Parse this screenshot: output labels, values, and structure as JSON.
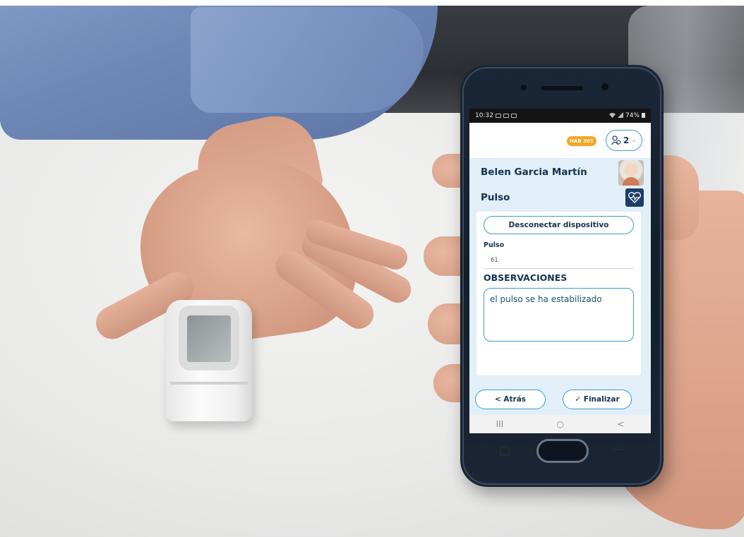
{
  "statusbar": {
    "time": "10:32",
    "notification_icons": [
      "message-icon",
      "mail-icon",
      "image-icon"
    ],
    "battery": "74%",
    "system_icons": [
      "wifi-icon",
      "signal-icon",
      "battery-icon"
    ]
  },
  "header": {
    "room_badge": "HAB 301",
    "users_count": "2",
    "users_icon": "users-icon",
    "chevron_icon": "chevron-down-icon"
  },
  "patient": {
    "name": "Belen Garcia Martín",
    "avatar_icon": "patient-avatar"
  },
  "measurement": {
    "name": "Pulso",
    "icon": "heart-pulse-icon"
  },
  "form": {
    "disconnect_label": "Desconectar dispositivo",
    "field_label": "Pulso",
    "field_value": "61",
    "observations_label": "OBSERVACIONES",
    "observations_text": "el pulso se ha estabilizado"
  },
  "footer": {
    "back_label": "< Atrás",
    "finish_label": "✓ Finalizar"
  },
  "navbar": {
    "recent": "III",
    "home": "○",
    "back": "<"
  },
  "colors": {
    "accent": "#3c9ccf",
    "navy": "#15324f",
    "badge": "#f5a623",
    "panel": "#e2eff8"
  }
}
